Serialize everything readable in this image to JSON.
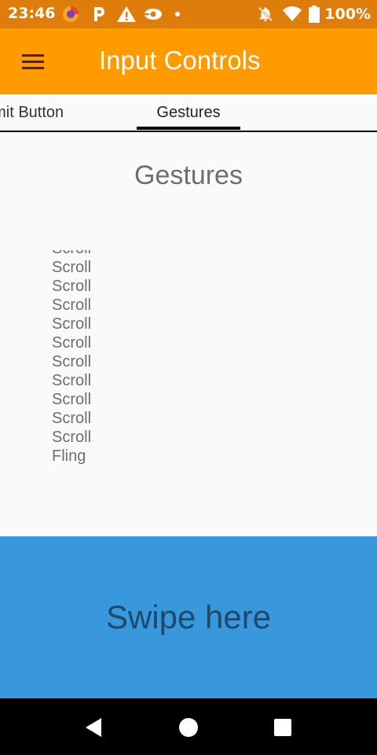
{
  "status_bar": {
    "time": "23:46",
    "battery": "100%",
    "icons": [
      "firefox-icon",
      "pocket-icon",
      "warning-icon",
      "nav-app-icon",
      "dot-icon",
      "notifications-off-icon",
      "wifi-icon",
      "battery-icon"
    ]
  },
  "app_bar": {
    "title": "Input Controls",
    "menu_icon": "hamburger-menu-icon"
  },
  "tabs": [
    {
      "label": "Submit Button",
      "visible_label": "omit Button"
    },
    {
      "label": "Gestures",
      "visible_label": "Gestures",
      "selected": true
    }
  ],
  "content": {
    "title": "Gestures",
    "log": [
      "Scroll",
      "Scroll",
      "Scroll",
      "Scroll",
      "Scroll",
      "Scroll",
      "Scroll",
      "Scroll",
      "Scroll",
      "Scroll",
      "Scroll",
      "Fling"
    ]
  },
  "swipe_area": {
    "label": "Swipe here",
    "color": "#3898db"
  },
  "colors": {
    "status_bar": "#df7d0c",
    "app_bar": "#ff9a00",
    "nav_bar": "#000000"
  }
}
